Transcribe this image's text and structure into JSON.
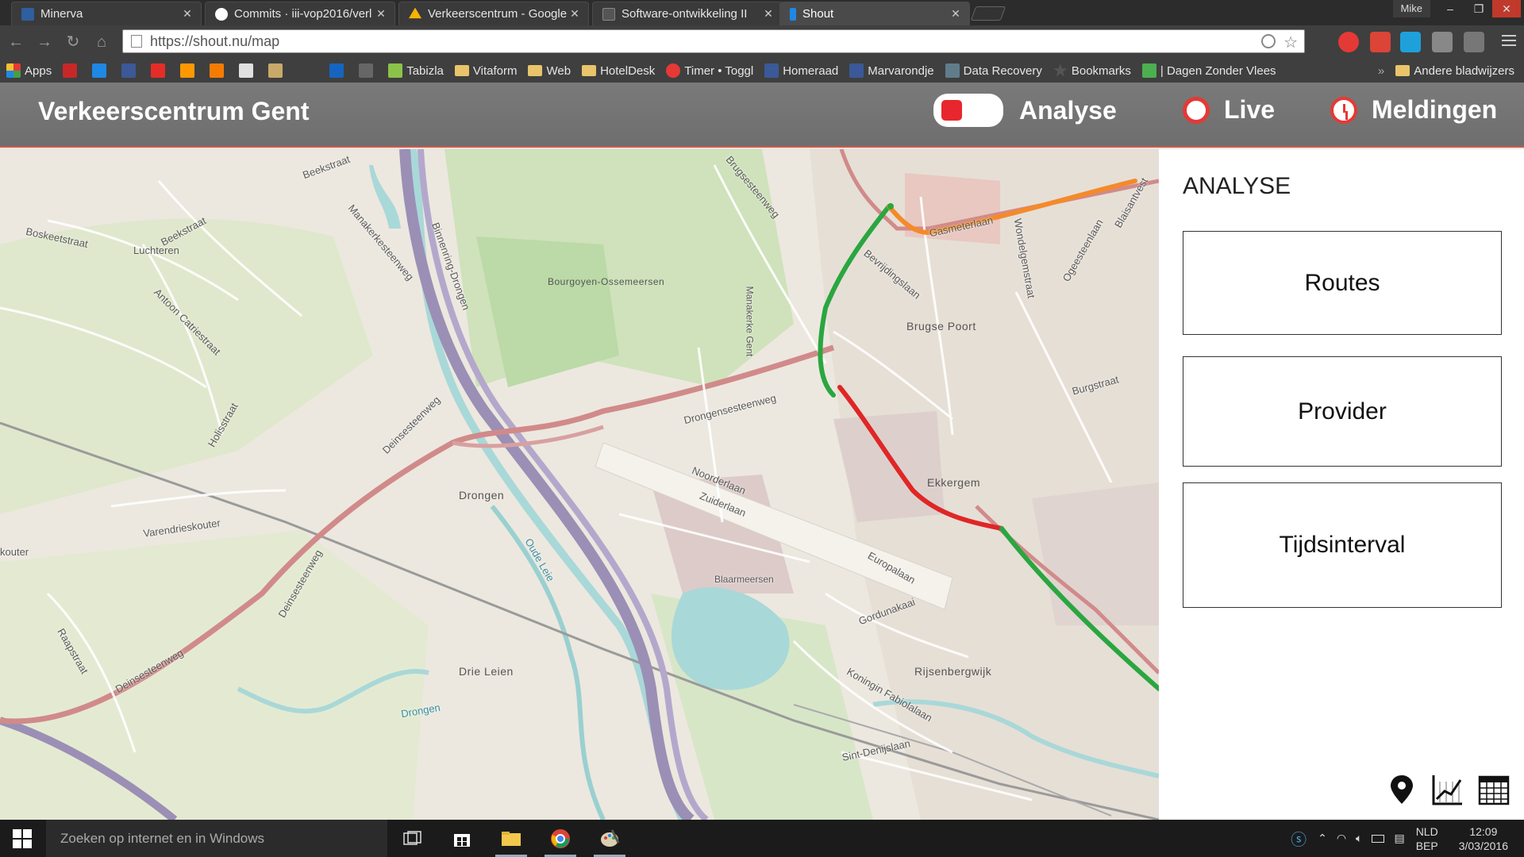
{
  "browser": {
    "tabs": [
      {
        "label": "Minerva",
        "color": "#2f5f9e"
      },
      {
        "label": "Commits · iii-vop2016/verl",
        "color": "#ffffff"
      },
      {
        "label": "Verkeerscentrum - Google",
        "color": "#f4b400"
      },
      {
        "label": "Software-ontwikkeling II",
        "color": "#666666"
      },
      {
        "label": "Shout",
        "color": "#1e88e5"
      }
    ],
    "user": "Mike",
    "window_controls": [
      "‒",
      "❐",
      "✕"
    ],
    "url": "https://shout.nu/map",
    "bookmarks": {
      "apps_label": "Apps",
      "items": [
        "Tabizla",
        "Vitaform",
        "Web",
        "HotelDesk",
        "Timer • Toggl",
        "Homeraad",
        "Marvarondje",
        "Data Recovery",
        "Bookmarks",
        "| Dagen Zonder Vlees"
      ],
      "other": "Andere bladwijzers"
    }
  },
  "app": {
    "title": "Verkeerscentrum Gent",
    "nav": {
      "analyse": "Analyse",
      "live": "Live",
      "meldingen": "Meldingen"
    }
  },
  "panel": {
    "title": "ANALYSE",
    "buttons": {
      "routes": "Routes",
      "provider": "Provider",
      "tijdsinterval": "Tijdsinterval"
    },
    "tools": [
      "map-pin-icon",
      "chart-icon",
      "calendar-icon"
    ]
  },
  "map": {
    "streets": {
      "beekstraat": "Beekstraat",
      "boskeetstraat": "Boskeetstraat",
      "beekstraat2": "Beekstraat",
      "luchteren": "Luchteren",
      "manakerke": "Manakerkesteenweg",
      "binnenring": "Binnenring-Drongen",
      "bourgoyen": "Bourgoyen-Ossemeersen",
      "antoon": "Antoon Catriestraat",
      "holisstraat": "Holisstraat",
      "deinsesteenweg": "Deinsesteenweg",
      "drongensesteenweg": "Drongensesteenweg",
      "noorderlaan": "Noorderlaan",
      "zuiderlaan": "Zuiderlaan",
      "varendrieskouter": "Varendrieskouter",
      "kouter": "kouter",
      "oude_leie": "Oude Leie",
      "blaarmeersen": "Blaarmeersen",
      "europalaan": "Europalaan",
      "gordunakaai": "Gordunakaai",
      "raapstraat": "Raapstraat",
      "deinsesteenweg2": "Deinsesteenweg",
      "deinsesteenweg3": "Deinsesteenweg",
      "drongen_river": "Drongen",
      "koningin": "Koningin Fabiolalaan",
      "sint": "Sint-Denijslaan",
      "brugsesteenweg": "Brugsesteenweg",
      "gasmeterlaan": "Gasmeterlaan",
      "wondelgem": "Wondelgemstraat",
      "bevrijdingslaan": "Bevrijdingslaan",
      "ogeerstee": "Ogeesteenlaan",
      "burgstraat": "Burgstraat",
      "blaisantvest": "Blaisantvest",
      "marmerkerke": "Manakerke Gent"
    },
    "places": {
      "drongen": "Drongen",
      "drie_leien": "Drie Leien",
      "ekkergem": "Ekkergem",
      "rijsenbergwijk": "Rijsenbergwijk",
      "brugse_poort": "Brugse Poort"
    }
  },
  "taskbar": {
    "search_placeholder": "Zoeken op internet en in Windows",
    "lang_top": "NLD",
    "lang_bottom": "BEP",
    "time": "12:09",
    "date": "3/03/2016"
  }
}
